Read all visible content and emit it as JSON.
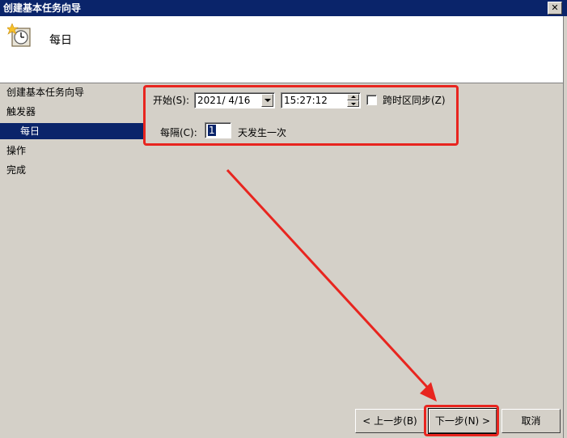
{
  "window": {
    "title": "创建基本任务向导",
    "close_label": "✕"
  },
  "header": {
    "title": "每日",
    "icon": "clock-icon"
  },
  "nav": [
    {
      "label": "创建基本任务向导"
    },
    {
      "label": "触发器"
    },
    {
      "label": "每日"
    },
    {
      "label": "操作"
    },
    {
      "label": "完成"
    }
  ],
  "form": {
    "start_label": "开始(S):",
    "start_date": "2021/ 4/16",
    "start_time": "15:27:12",
    "sync_label": "跨时区同步(Z)",
    "recur_label": "每隔(C):",
    "recur_value": "1",
    "recur_suffix": "天发生一次"
  },
  "buttons": {
    "back": "< 上一步(B)",
    "next": "下一步(N) >",
    "cancel": "取消"
  },
  "colors": {
    "annotation": "#e8251f",
    "selection": "#0a246a"
  }
}
